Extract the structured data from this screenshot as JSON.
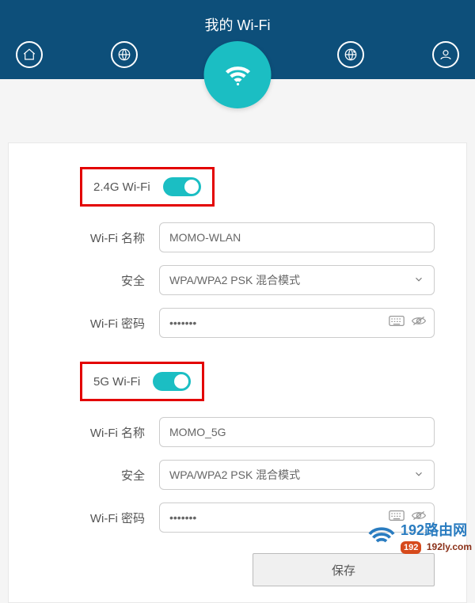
{
  "header": {
    "title": "我的 Wi-Fi"
  },
  "wifi24": {
    "section_label": "2.4G Wi-Fi",
    "name_label": "Wi-Fi 名称",
    "name_value": "MOMO-WLAN",
    "security_label": "安全",
    "security_value": "WPA/WPA2 PSK 混合模式",
    "password_label": "Wi-Fi 密码",
    "password_value": "•••••••"
  },
  "wifi5": {
    "section_label": "5G Wi-Fi",
    "name_label": "Wi-Fi 名称",
    "name_value": "MOMO_5G",
    "security_label": "安全",
    "security_value": "WPA/WPA2 PSK 混合模式",
    "password_label": "Wi-Fi 密码",
    "password_value": "•••••••"
  },
  "actions": {
    "save_label": "保存"
  },
  "watermark": {
    "title": "192路由网",
    "badge": "192",
    "url": "192ly.com"
  }
}
